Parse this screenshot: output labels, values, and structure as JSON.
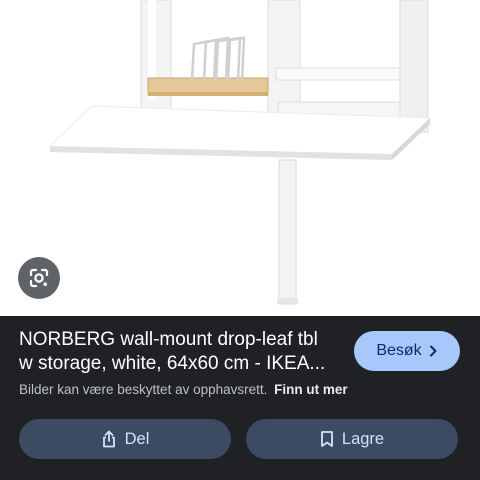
{
  "result": {
    "title_line1": "NORBERG wall-mount drop-leaf tbl",
    "title_line2": "w storage, white, 64x60 cm - IKEA...",
    "visit_label": "Besøk",
    "copyright_notice": "Bilder kan være beskyttet av opphavsrett.",
    "learn_more_label": "Finn ut mer"
  },
  "actions": {
    "share_label": "Del",
    "save_label": "Lagre"
  },
  "icons": {
    "lens": "google-lens-icon",
    "visit": "chevron-right-icon",
    "share": "share-icon",
    "save": "bookmark-icon"
  },
  "colors": {
    "panel_background": "#202124",
    "visit_button": "#a8c7fa",
    "action_button": "#3c4a62"
  }
}
